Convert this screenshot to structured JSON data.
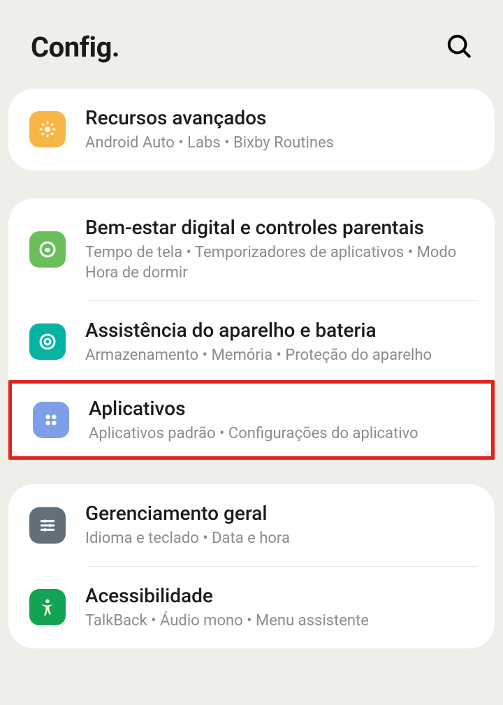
{
  "header": {
    "title": "Config."
  },
  "group1": {
    "advanced": {
      "title": "Recursos avançados",
      "sub": "Android Auto  •  Labs  •  Bixby Routines"
    }
  },
  "group2": {
    "wellbeing": {
      "title": "Bem-estar digital e controles parentais",
      "sub": "Tempo de tela  •  Temporizadores de aplicativos  •  Modo Hora de dormir"
    },
    "assist": {
      "title": "Assistência do aparelho e bateria",
      "sub": "Armazenamento  •  Memória  •  Proteção do aparelho"
    },
    "apps": {
      "title": "Aplicativos",
      "sub": "Aplicativos padrão  •  Configurações do aplicativo"
    }
  },
  "group3": {
    "general": {
      "title": "Gerenciamento geral",
      "sub": "Idioma e teclado  •  Data e hora"
    },
    "accessibility": {
      "title": "Acessibilidade",
      "sub": "TalkBack  •  Áudio mono  •  Menu assistente"
    }
  }
}
